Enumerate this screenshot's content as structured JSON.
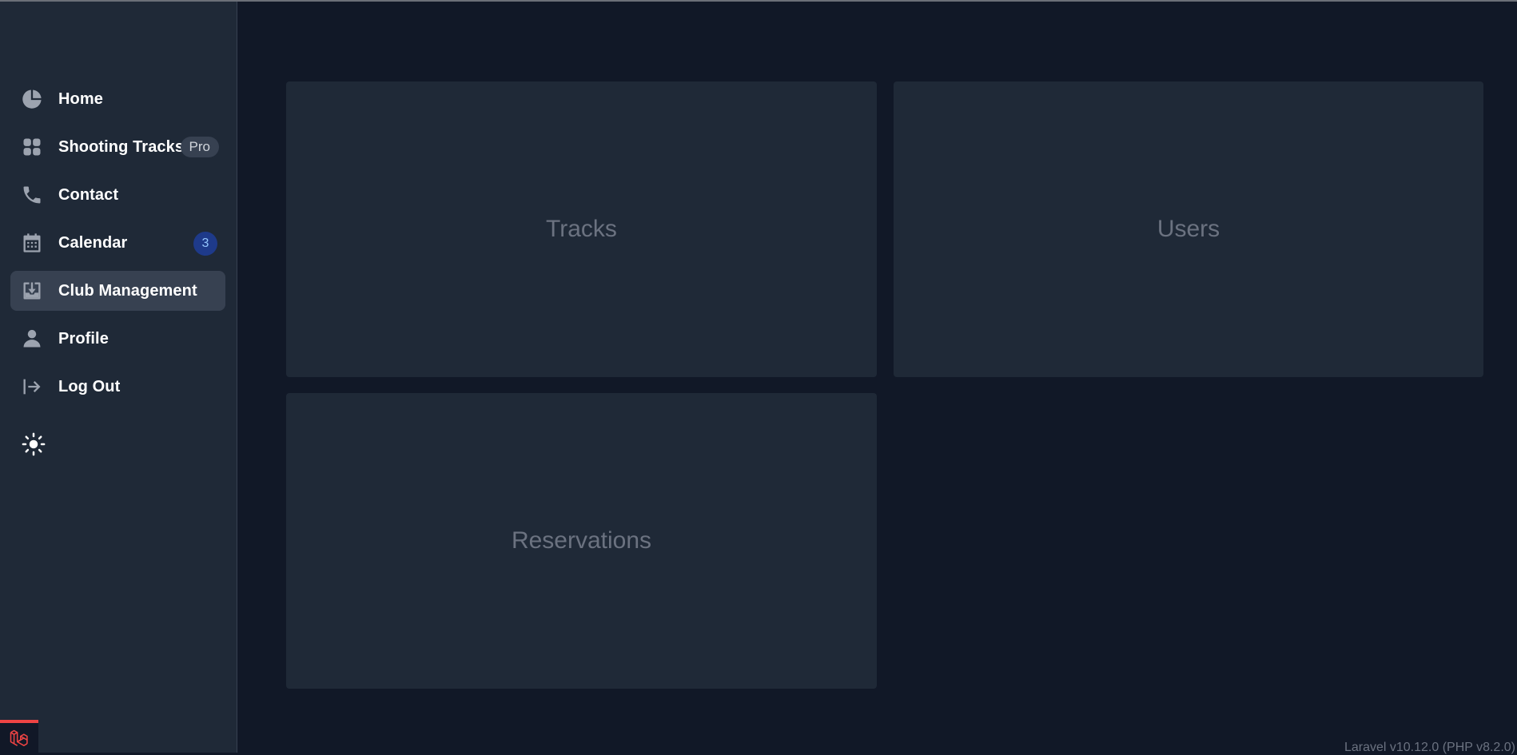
{
  "sidebar": {
    "items": [
      {
        "label": "Home",
        "icon": "pie-chart-icon"
      },
      {
        "label": "Shooting Tracks",
        "icon": "grid-icon",
        "badge": "Pro"
      },
      {
        "label": "Contact",
        "icon": "phone-icon"
      },
      {
        "label": "Calendar",
        "icon": "calendar-icon",
        "badge": "3"
      },
      {
        "label": "Club Management",
        "icon": "download-tray-icon",
        "active": true
      },
      {
        "label": "Profile",
        "icon": "user-icon"
      },
      {
        "label": "Log Out",
        "icon": "logout-icon"
      }
    ],
    "theme_toggle_icon": "sun-icon",
    "footer_logo_icon": "laravel-logo-icon"
  },
  "main": {
    "cards": [
      {
        "label": "Tracks"
      },
      {
        "label": "Users"
      },
      {
        "label": "Reservations"
      }
    ]
  },
  "footer": {
    "version": "Laravel v10.12.0 (PHP v8.2.0)"
  },
  "colors": {
    "page_bg": "#111827",
    "sidebar_bg": "#1f2937",
    "card_bg": "#1f2937",
    "active_item_bg": "#374151",
    "calendar_badge_bg": "#1e3a8a",
    "laravel_red": "#ef4444"
  }
}
